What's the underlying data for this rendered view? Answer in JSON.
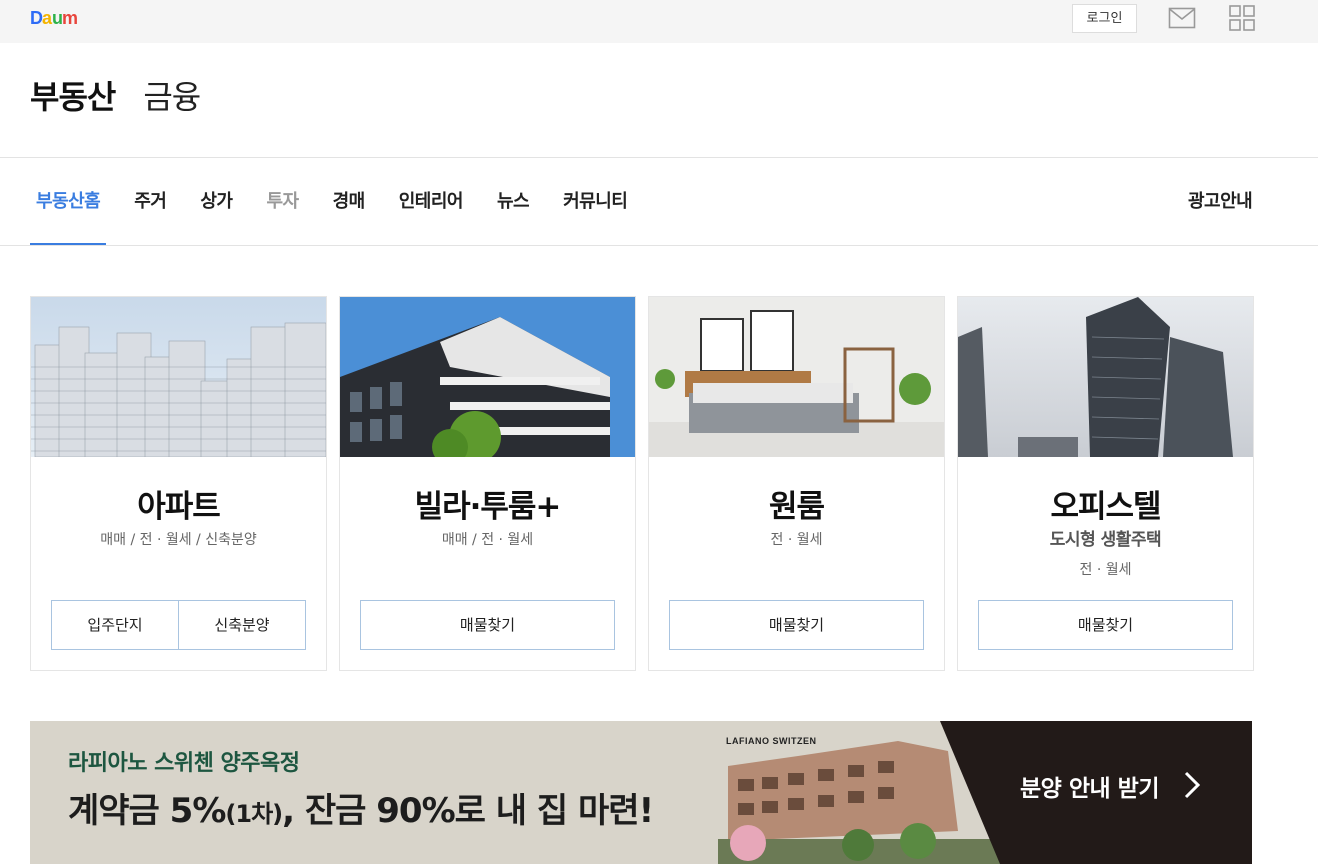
{
  "topbar": {
    "logo": "Daum",
    "login_label": "로그인",
    "mail_icon": "mail-icon",
    "apps_icon": "grid-icon"
  },
  "service": {
    "main": "부동산",
    "sub": "금융"
  },
  "gnb": {
    "items": [
      {
        "label": "부동산홈",
        "state": "active"
      },
      {
        "label": "주거",
        "state": "normal"
      },
      {
        "label": "상가",
        "state": "normal"
      },
      {
        "label": "투자",
        "state": "dim"
      },
      {
        "label": "경매",
        "state": "normal"
      },
      {
        "label": "인테리어",
        "state": "normal"
      },
      {
        "label": "뉴스",
        "state": "normal"
      },
      {
        "label": "커뮤니티",
        "state": "normal"
      }
    ],
    "ad_label": "광고안내",
    "accent_color": "#3a7de0"
  },
  "cards": [
    {
      "title": "아파트",
      "sub": "매매 / 전 · 월세 / 신축분양",
      "buttons": [
        "입주단지",
        "신축분양"
      ]
    },
    {
      "title": "빌라·투룸+",
      "sub": "매매 / 전 · 월세",
      "buttons": [
        "매물찾기"
      ]
    },
    {
      "title": "원룸",
      "sub": "전 · 월세",
      "buttons": [
        "매물찾기"
      ]
    },
    {
      "title": "오피스텔",
      "sub_bold": "도시형 생활주택",
      "sub": "전 · 월세",
      "buttons": [
        "매물찾기"
      ]
    }
  ],
  "banner": {
    "subtitle": "라피아노 스위첸 양주옥정",
    "main_a": "계약금 5%",
    "main_b": "(1차)",
    "main_c": ", 잔금 90%로 내 집 마련!",
    "brand": "LAFIANO SWITZEN",
    "cta": "분양 안내 받기",
    "arrow_icon": "chevron-right-icon"
  }
}
